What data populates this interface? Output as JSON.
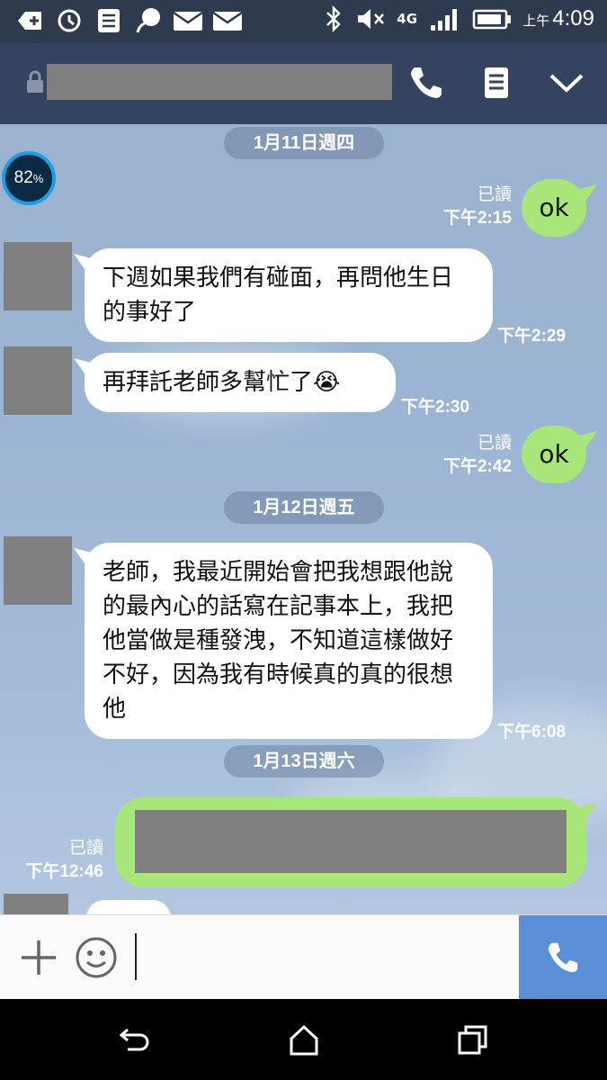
{
  "status_bar": {
    "network": "4G",
    "time_prefix": "上午",
    "time": "4:09"
  },
  "header": {
    "contact_name": "",
    "icons": [
      "lock-icon",
      "phone-icon",
      "notes-icon",
      "chevron-down-icon"
    ]
  },
  "battery_badge": {
    "value": "82",
    "unit": "%"
  },
  "chat": {
    "dates": [
      "1月11日週四",
      "1月12日週五",
      "1月13日週六"
    ],
    "messages": [
      {
        "dir": "out",
        "text": "ok",
        "read": "已讀",
        "time": "下午2:15"
      },
      {
        "dir": "in",
        "text": "下週如果我們有碰面，再問他生日的事好了",
        "time": "下午2:29"
      },
      {
        "dir": "in",
        "text": "再拜託老師多幫忙了",
        "emoji": "😭",
        "time": "下午2:30"
      },
      {
        "dir": "out",
        "text": "ok",
        "read": "已讀",
        "time": "下午2:42"
      },
      {
        "dir": "in",
        "text": "老師，我最近開始會把我想跟他說的最內心的話寫在記事本上，我把他當做是種發洩，不知道這樣做好不好，因為我有時候真的真的很想他",
        "time": "下午6:08"
      },
      {
        "dir": "out",
        "text": "",
        "read": "已讀",
        "time": "下午12:46"
      }
    ]
  },
  "colors": {
    "header_bg": "#354260",
    "status_bg": "#2f3a4f",
    "outgoing_bubble": "#a9e67a",
    "incoming_bubble": "#ffffff",
    "call_button": "#5a8fd8"
  }
}
